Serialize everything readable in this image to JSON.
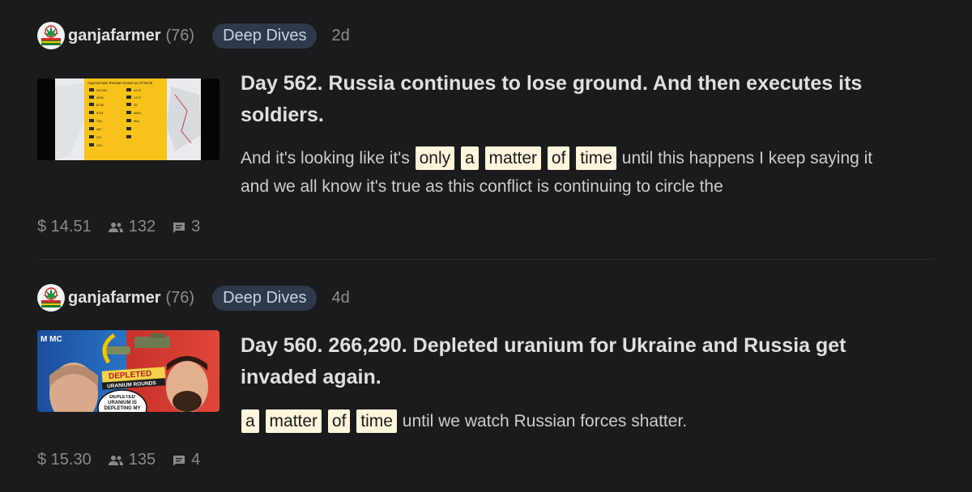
{
  "posts": [
    {
      "author": "ganjafarmer",
      "reputation": "(76)",
      "community": "Deep Dives",
      "age": "2d",
      "title": "Day 562. Russia continues to lose ground. And then executes its soldiers.",
      "excerpt": {
        "before": "And it's looking like it's",
        "highlights": [
          "only",
          "a",
          "matter",
          "of",
          "time"
        ],
        "after": "until this happens I keep saying it and we all know it's true as this conflict is continuing to circle the"
      },
      "payout": "$ 14.51",
      "votes": "132",
      "comments": "3",
      "thumbnail_icon": "infographic-thumbnail"
    },
    {
      "author": "ganjafarmer",
      "reputation": "(76)",
      "community": "Deep Dives",
      "age": "4d",
      "title": "Day 560. 266,290. Depleted uranium for Ukraine and Russia get invaded again.",
      "excerpt": {
        "before": "",
        "highlights": [
          "a",
          "matter",
          "of",
          "time"
        ],
        "after": "until we watch Russian forces shatter."
      },
      "payout": "$ 15.30",
      "votes": "135",
      "comments": "4",
      "thumbnail_icon": "video-thumbnail",
      "thumbnail_text": {
        "channel": "M MC",
        "banner_1": "DEPLETED",
        "banner_2": "URANIUM ROUNDS",
        "bubble": "DEPLETED URANIUM IS DEPLETING MY ARMY"
      }
    }
  ],
  "thumb1_text": {
    "heading": "Approximate Russian losses as of 06.09",
    "rows": [
      "267540",
      "4520",
      "8726",
      "5701",
      "754",
      "457",
      "311",
      "315",
      "4275",
      "1472",
      "19",
      "8264",
      "868"
    ]
  },
  "colors": {
    "background": "#1b1a1c",
    "tag_bg": "#2e3a4b",
    "highlight": "#fdf6dc",
    "thumb1_yellow": "#f7c31a"
  }
}
